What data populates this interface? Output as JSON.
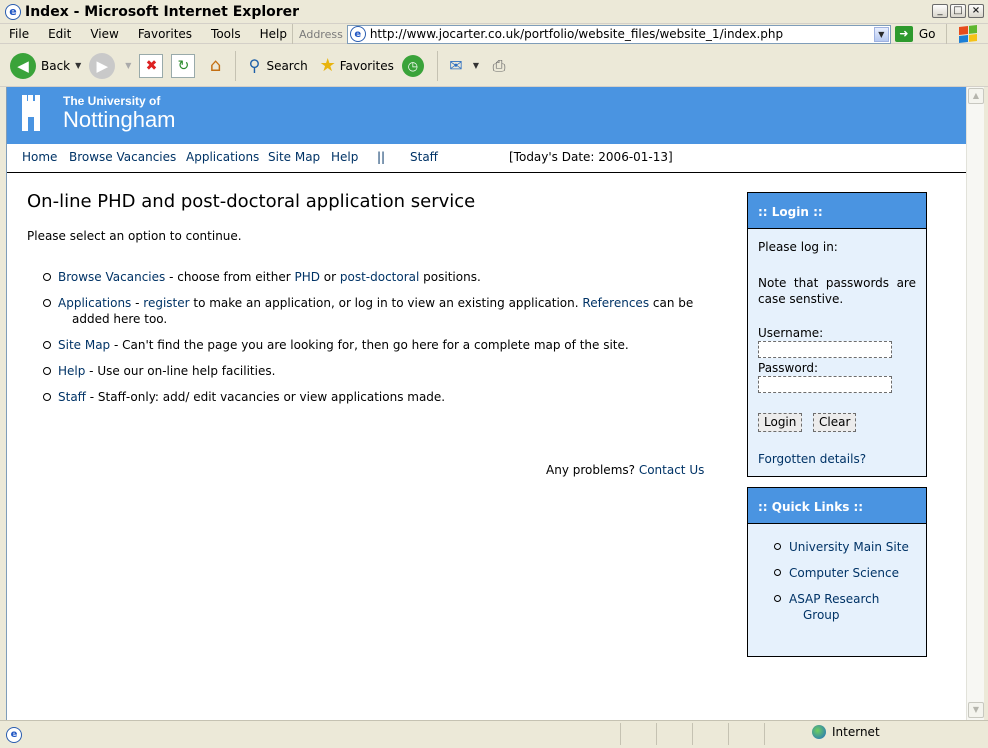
{
  "window": {
    "title": "Index - Microsoft Internet Explorer",
    "controls": [
      "minimize",
      "maximize",
      "close"
    ]
  },
  "menubar": {
    "items": [
      "File",
      "Edit",
      "View",
      "Favorites",
      "Tools",
      "Help"
    ],
    "address_label": "Address",
    "url": "http://www.jocarter.co.uk/portfolio/website_files/website_1/index.php",
    "go_label": "Go"
  },
  "toolbar": {
    "back_label": "Back",
    "search_label": "Search",
    "favorites_label": "Favorites"
  },
  "banner": {
    "logo_line1": "The University of",
    "logo_line2": "Nottingham"
  },
  "nav": {
    "items": [
      "Home",
      "Browse Vacancies",
      "Applications",
      "Site Map",
      "Help"
    ],
    "separator": "||",
    "staff": "Staff",
    "date": "[Today's Date: 2006-01-13]"
  },
  "main": {
    "heading": "On-line PHD and post-doctoral application service",
    "intro": "Please select an option to continue.",
    "options": [
      {
        "link": "Browse Vacancies",
        "t1": " - choose from either ",
        "link2": "PHD",
        "t2": " or ",
        "link3": "post-doctoral",
        "t3": " positions."
      },
      {
        "link": "Applications",
        "t1": " - ",
        "link2": "register",
        "t2": " to make an application, or log in to view an existing application. ",
        "link3": "References",
        "t3": " can be",
        "t4": "added here too."
      },
      {
        "link": "Site Map",
        "t1": " - Can't find the page you are looking for, then go here for a complete map of the site."
      },
      {
        "link": "Help",
        "t1": " - Use our on-line help facilities."
      },
      {
        "link": "Staff",
        "t1": " - Staff-only: add/ edit vacancies or view applications made."
      }
    ],
    "problems_text": "Any problems? ",
    "contact_link": "Contact Us"
  },
  "login": {
    "title": ":: Login ::",
    "prompt": "Please log in:",
    "note": "Note that passwords are case senstive.",
    "username_label": "Username:",
    "password_label": "Password:",
    "login_button": "Login",
    "clear_button": "Clear",
    "forgotten": "Forgotten details?"
  },
  "quicklinks": {
    "title": ":: Quick Links ::",
    "items": [
      "University Main Site",
      "Computer Science",
      "ASAP Research",
      "Group"
    ]
  },
  "status": {
    "zone": "Internet"
  },
  "colors": {
    "banner": "#4a94e1",
    "box_bg": "#e6f1fc",
    "link": "#003366"
  }
}
